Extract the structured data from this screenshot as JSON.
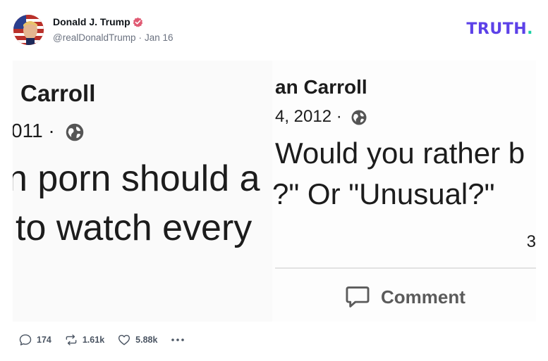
{
  "post": {
    "author": {
      "display_name": "Donald J. Trump",
      "handle": "@realDonaldTrump",
      "date": "Jan 16",
      "separator": "·"
    },
    "logo": {
      "text": "TRUTH",
      "dot": "."
    },
    "media": {
      "left_panel": {
        "name": "Carroll",
        "date": "011 ·",
        "text_line1": "n porn should a",
        "text_line2": "to watch every"
      },
      "right_panel": {
        "name": "an Carroll",
        "date": "4, 2012 ·",
        "text_line1": "Would you rather b",
        "text_line2": "?\" Or \"Unusual?\"",
        "count": "3",
        "comment_label": "Comment"
      }
    },
    "actions": {
      "replies": "174",
      "retruths": "1.61k",
      "likes": "5.88k"
    }
  },
  "colors": {
    "brand": "#5c41e8",
    "brand_dot": "#1bd1a5",
    "verified": "#e05a73",
    "meta_text": "#6b7280"
  },
  "icons": {
    "verified": "verified-badge-icon",
    "reply": "speech-bubble-icon",
    "retruth": "retruth-icon",
    "like": "heart-icon",
    "more": "more-dots-icon",
    "globe": "globe-icon",
    "comment": "comment-bubble-icon"
  }
}
